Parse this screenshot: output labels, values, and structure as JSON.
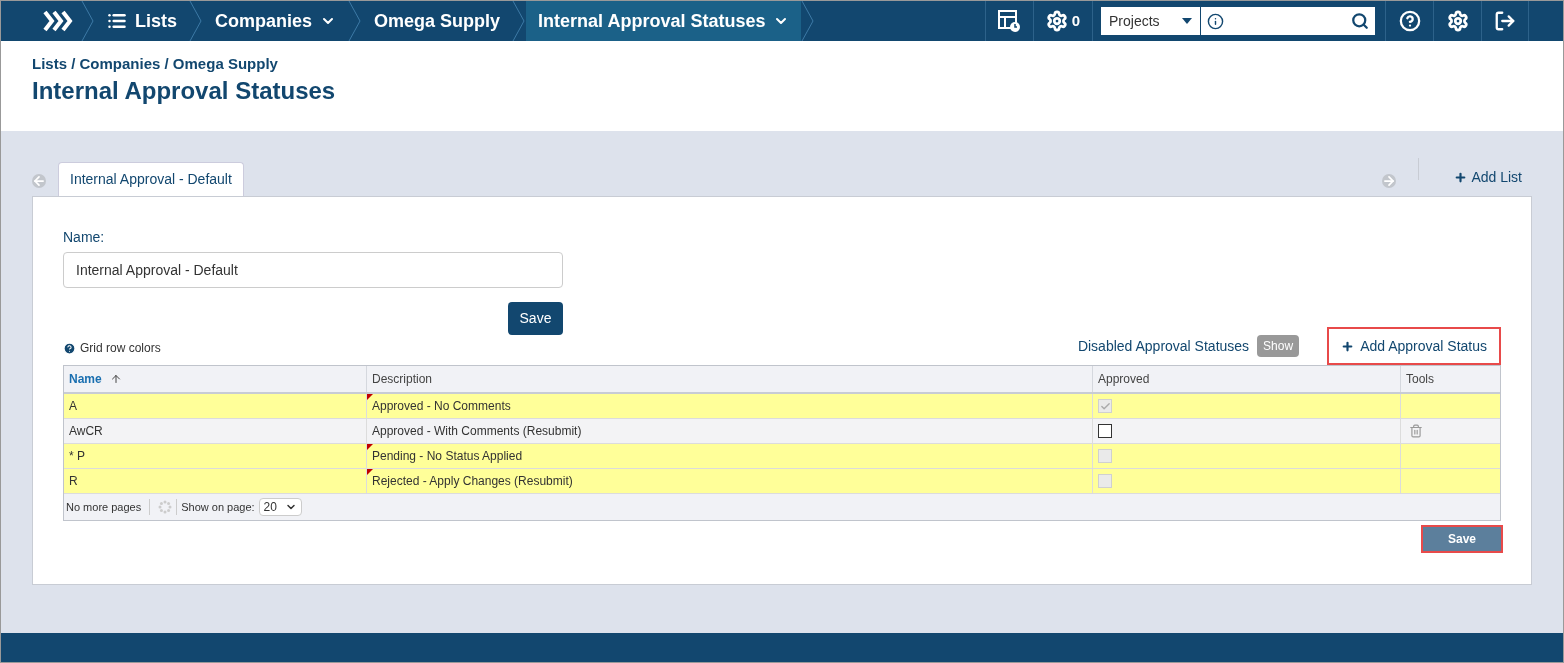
{
  "topnav": {
    "crumbs": [
      {
        "label": "Lists",
        "dropdown": false,
        "selected": false
      },
      {
        "label": "Companies",
        "dropdown": true,
        "selected": false
      },
      {
        "label": "Omega Supply",
        "dropdown": false,
        "selected": false
      },
      {
        "label": "Internal Approval Statuses",
        "dropdown": true,
        "selected": true
      }
    ],
    "jobs_count": "0",
    "search_scope": "Projects"
  },
  "header": {
    "breadcrumb": "Lists / Companies / Omega Supply",
    "title": "Internal Approval Statuses"
  },
  "tabs": [
    {
      "label": "Internal Approval - Default",
      "selected": true
    }
  ],
  "add_list": "Add List",
  "form": {
    "name_label": "Name:",
    "name_value": "Internal Approval - Default",
    "save": "Save"
  },
  "grid_help": "Grid row colors",
  "disabled_label": "Disabled Approval Statuses",
  "show_button": "Show",
  "add_status": {
    "label": "Add Approval Status",
    "highlighted": true
  },
  "table": {
    "columns": [
      {
        "label": "Name",
        "sorted": true
      },
      {
        "label": "Description",
        "sorted": false
      },
      {
        "label": "Approved",
        "sorted": false
      },
      {
        "label": "Tools",
        "sorted": false
      }
    ],
    "rows": [
      {
        "name": "A",
        "description": "Approved - No Comments",
        "highlighted": true,
        "note": true,
        "checked": true,
        "disabled": true,
        "deletable": false
      },
      {
        "name": "AwCR",
        "description": "Approved - With Comments (Resubmit)",
        "highlighted": false,
        "note": false,
        "checked": false,
        "disabled": false,
        "deletable": true
      },
      {
        "name": "* P",
        "description": "Pending - No Status Applied",
        "highlighted": true,
        "note": true,
        "checked": false,
        "disabled": true,
        "deletable": false
      },
      {
        "name": "R",
        "description": "Rejected - Apply Changes (Resubmit)",
        "highlighted": true,
        "note": true,
        "checked": false,
        "disabled": true,
        "deletable": false
      }
    ],
    "pager": {
      "status": "No more pages",
      "show_label": "Show on page:",
      "page_size": "20"
    }
  },
  "bottom_save": {
    "label": "Save",
    "highlighted": true
  }
}
